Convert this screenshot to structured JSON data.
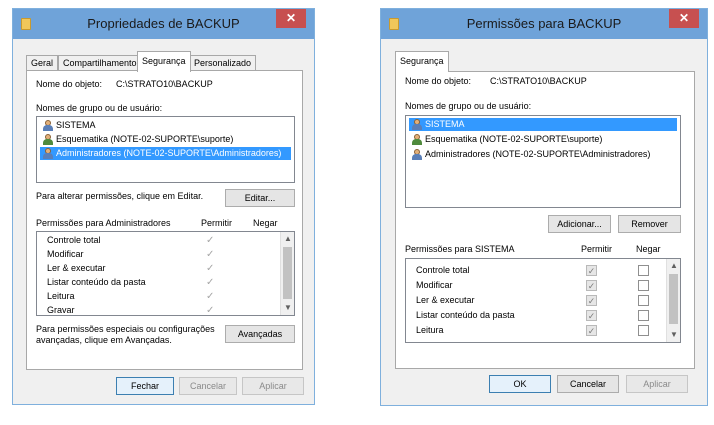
{
  "left_window": {
    "title": "Propriedades de BACKUP",
    "tabs": [
      "Geral",
      "Compartilhamento",
      "Segurança",
      "Personalizado"
    ],
    "object_name_label": "Nome do objeto:",
    "object_name_value": "C:\\STRATO10\\BACKUP",
    "group_label": "Nomes de grupo ou de usuário:",
    "users": [
      {
        "name": "SISTEMA",
        "icon": "group-users-icon"
      },
      {
        "name": "Esquematika (NOTE-02-SUPORTE\\suporte)",
        "icon": "user-icon"
      },
      {
        "name": "Administradores (NOTE-02-SUPORTE\\Administradores)",
        "icon": "group-users-icon"
      }
    ],
    "edit_hint": "Para alterar permissões, clique em Editar.",
    "edit_button": "Editar...",
    "permissions_header": "Permissões para Administradores",
    "allow_header": "Permitir",
    "deny_header": "Negar",
    "permissions": [
      "Controle total",
      "Modificar",
      "Ler & executar",
      "Listar conteúdo da pasta",
      "Leitura",
      "Gravar"
    ],
    "special_hint_line1": "Para permissões especiais ou configurações",
    "special_hint_line2": "avançadas, clique em Avançadas.",
    "advanced_button": "Avançadas",
    "close_button": "Fechar",
    "cancel_button": "Cancelar",
    "apply_button": "Aplicar"
  },
  "right_window": {
    "title": "Permissões para BACKUP",
    "tab": "Segurança",
    "object_name_label": "Nome do objeto:",
    "object_name_value": "C:\\STRATO10\\BACKUP",
    "group_label": "Nomes de grupo ou de usuário:",
    "users": [
      {
        "name": "SISTEMA",
        "icon": "group-users-icon"
      },
      {
        "name": "Esquematika (NOTE-02-SUPORTE\\suporte)",
        "icon": "user-icon"
      },
      {
        "name": "Administradores (NOTE-02-SUPORTE\\Administradores)",
        "icon": "group-users-icon"
      }
    ],
    "add_button": "Adicionar...",
    "remove_button": "Remover",
    "permissions_header": "Permissões para SISTEMA",
    "allow_header": "Permitir",
    "deny_header": "Negar",
    "permissions": [
      "Controle total",
      "Modificar",
      "Ler & executar",
      "Listar conteúdo da pasta",
      "Leitura"
    ],
    "ok_button": "OK",
    "cancel_button": "Cancelar",
    "apply_button": "Aplicar"
  },
  "colors": {
    "titlebar": "#6fa3d9",
    "close_button": "#c75050",
    "selection": "#3399ff"
  }
}
